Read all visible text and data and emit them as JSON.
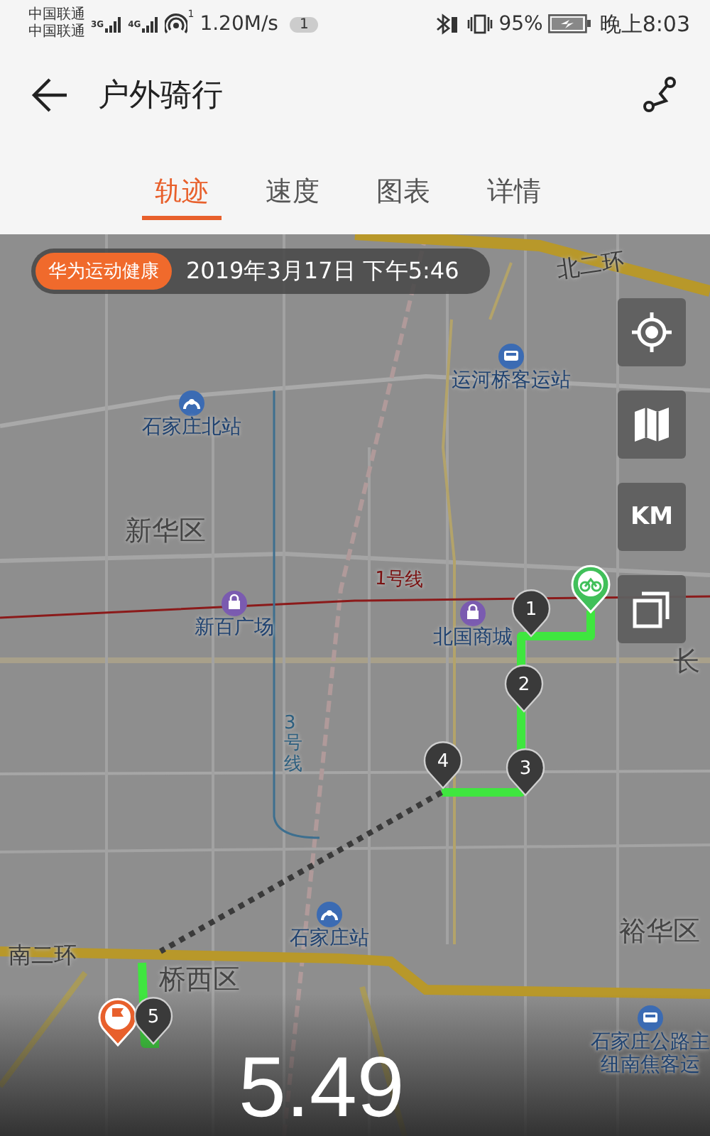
{
  "status_bar": {
    "carriers": [
      "中国联通",
      "中国联通"
    ],
    "network_types": [
      "3G",
      "4G"
    ],
    "hotspot_index": "1",
    "speed": "1.20M/s",
    "notification_count": "1",
    "battery": "95%",
    "time": "晚上8:03"
  },
  "header": {
    "title": "户外骑行"
  },
  "tabs": [
    {
      "label": "轨迹",
      "selected": true
    },
    {
      "label": "速度",
      "selected": false
    },
    {
      "label": "图表",
      "selected": false
    },
    {
      "label": "详情",
      "selected": false
    }
  ],
  "map": {
    "brand_badge": "华为运动健康",
    "date": "2019年3月17日 下午5:46",
    "controls": [
      {
        "kind": "locate"
      },
      {
        "kind": "map"
      },
      {
        "kind": "unit",
        "label": "KM"
      },
      {
        "kind": "layers"
      }
    ],
    "labels": [
      {
        "kind": "road",
        "text": "北二环"
      },
      {
        "kind": "district",
        "text": "新华区"
      },
      {
        "kind": "line",
        "text": "1号线"
      },
      {
        "kind": "vline",
        "text": "3号线"
      },
      {
        "kind": "district",
        "text": "长"
      },
      {
        "kind": "road",
        "text": "南二环"
      },
      {
        "kind": "district",
        "text": "桥西区"
      },
      {
        "kind": "district",
        "text": "裕华区"
      }
    ],
    "places": [
      {
        "kind": "bus",
        "lines": [
          "运河桥客运站"
        ]
      },
      {
        "kind": "train",
        "lines": [
          "石家庄北站"
        ]
      },
      {
        "kind": "mall",
        "lines": [
          "新百广场"
        ]
      },
      {
        "kind": "mall",
        "lines": [
          "北国商城"
        ]
      },
      {
        "kind": "train",
        "lines": [
          "石家庄站"
        ]
      },
      {
        "kind": "bus",
        "lines": [
          "石家庄公路主",
          "纽南焦客运"
        ]
      }
    ],
    "markers": [
      "1",
      "2",
      "3",
      "4",
      "5"
    ],
    "distance": "5.49"
  }
}
